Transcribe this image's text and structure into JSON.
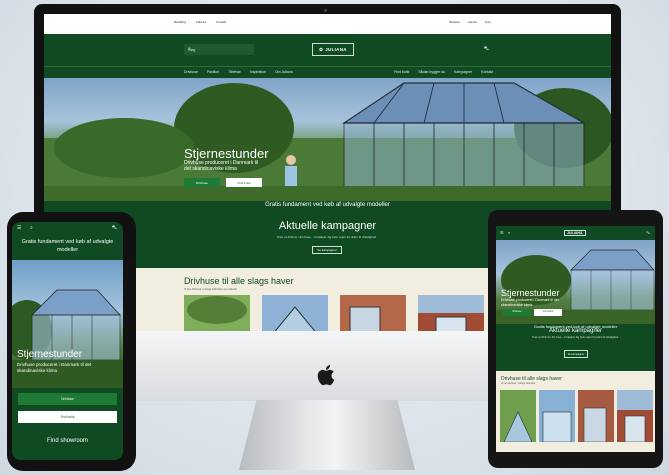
{
  "desktop": {
    "topbar_links": [
      "Bestilling",
      "Faktura",
      "Kontakt"
    ],
    "topbar_right": [
      "Butikker",
      "Dansk",
      "Kurv"
    ],
    "search_placeholder": "Søg",
    "logo": "JULIANA",
    "nav_left": [
      "Drivhuse",
      "Pavilion",
      "Tilbehør",
      "Inspiration",
      "Om Juliana"
    ],
    "nav_right": [
      "Find butik",
      "Sådan bygger du",
      "Kampagner",
      "Kontakt"
    ],
    "hero_title": "Stjernestunder",
    "hero_subtitle": "Drivhuse produceret i Danmark til det skandinaviske klima",
    "hero_btn_primary": "Drivhuse",
    "hero_btn_secondary": "Find butik",
    "promo_bar": "Gratis fundament ved køb af udvalgte modeller",
    "campaigns_title": "Aktuelle kampagner",
    "campaigns_text": "Prøv et drivhus i din have - vi hjælper dig hele vejen fra drøm til virkelighed.",
    "campaigns_btn": "Se kampagner",
    "section_title": "Drivhuse til alle slags haver",
    "section_sub": "Vi har drivhuse i mange størrelser og modeller"
  },
  "phone": {
    "promo": "Gratis fundament ved køb af udvalgte modeller",
    "hero_title": "Stjernestunder",
    "hero_subtitle": "Drivhuse produceret i Danmark til det skandinaviske klima",
    "btn_primary": "Drivhuse",
    "btn_secondary": "Find butik",
    "find": "Find showroom"
  },
  "tablet": {
    "logo": "JULIANA",
    "hero_title": "Stjernestunder",
    "hero_subtitle": "Drivhuse produceret i Danmark til det skandinaviske klima",
    "btn_primary": "Drivhuse",
    "btn_secondary": "Find butik",
    "promo": "Gratis fundament ved køb af udvalgte modeller",
    "campaigns_title": "Aktuelle kampagner",
    "campaigns_text": "Prøv et drivhus i din have - vi hjælper dig hele vejen fra drøm til virkelighed.",
    "campaigns_btn": "Se kampagner",
    "section_title": "Drivhuse til alle slags haver",
    "section_sub": "Vi har drivhuse i mange størrelser"
  },
  "colors": {
    "brand_green": "#0f4a22",
    "accent_green": "#1f7a35",
    "beige": "#f2eedf"
  }
}
